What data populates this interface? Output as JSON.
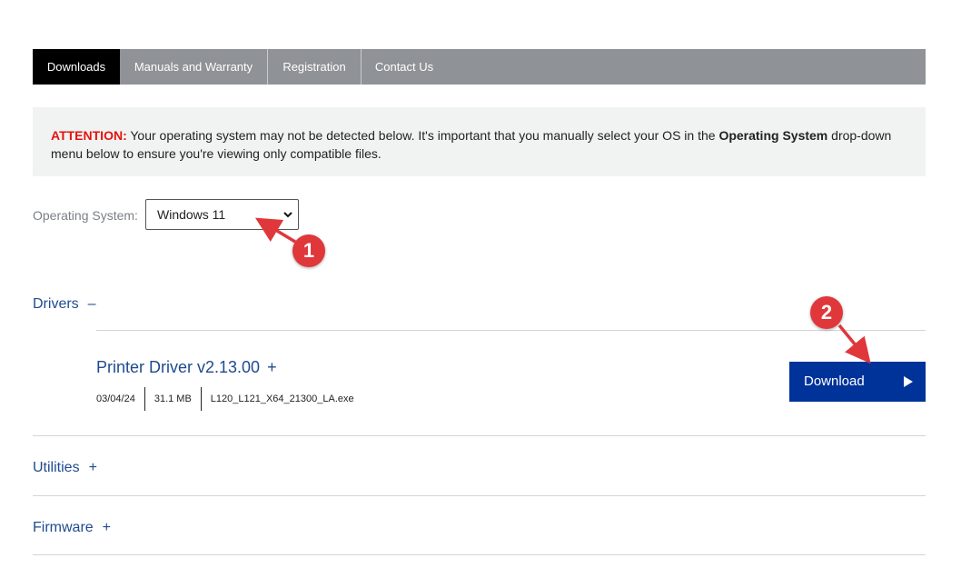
{
  "tabs": [
    {
      "label": "Downloads",
      "active": true
    },
    {
      "label": "Manuals and Warranty",
      "active": false
    },
    {
      "label": "Registration",
      "active": false
    },
    {
      "label": "Contact Us",
      "active": false
    }
  ],
  "attention": {
    "label": "ATTENTION:",
    "text_1": " Your operating system may not be detected below. It's important that you manually select your OS in the ",
    "bold": "Operating System",
    "text_2": " drop-down menu below to ensure you're viewing only compatible files."
  },
  "os": {
    "label": "Operating System:",
    "selected": "Windows 11"
  },
  "sections": {
    "drivers": {
      "label": "Drivers",
      "sign": "–"
    },
    "utilities": {
      "label": "Utilities",
      "sign": "+"
    },
    "firmware": {
      "label": "Firmware",
      "sign": "+"
    }
  },
  "driver": {
    "name": "Printer Driver v2.13.00",
    "sign": "+",
    "date": "03/04/24",
    "size": "31.1 MB",
    "file": "L120_L121_X64_21300_LA.exe",
    "download_label": "Download"
  },
  "annotations": {
    "badge_1": "1",
    "badge_2": "2"
  },
  "colors": {
    "brand_blue": "#003399",
    "link_blue": "#1f4b8f",
    "attention_red": "#e3140f",
    "annotation_red": "#e0373a",
    "tab_gray": "#8f9296"
  }
}
